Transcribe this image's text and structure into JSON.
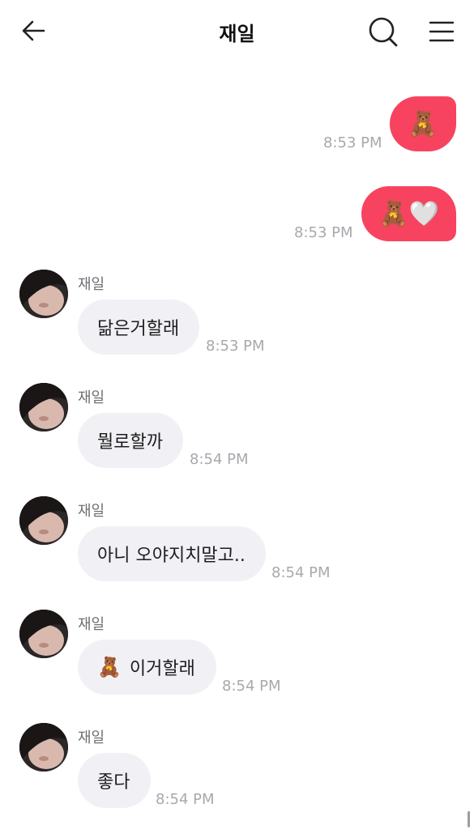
{
  "header": {
    "title": "재일"
  },
  "messages": [
    {
      "type": "outgoing",
      "emoji": "🧸",
      "time": "8:53 PM"
    },
    {
      "type": "outgoing",
      "emoji": "🧸🤍",
      "time": "8:53 PM"
    },
    {
      "type": "incoming",
      "sender": "재일",
      "text": "닮은거할래",
      "time": "8:53 PM"
    },
    {
      "type": "incoming",
      "sender": "재일",
      "text": "뭘로할까",
      "time": "8:54 PM"
    },
    {
      "type": "incoming",
      "sender": "재일",
      "text": "아니 오야지치말고..",
      "time": "8:54 PM"
    },
    {
      "type": "incoming",
      "sender": "재일",
      "emoji": "🧸",
      "text": "이거할래",
      "time": "8:54 PM"
    },
    {
      "type": "incoming",
      "sender": "재일",
      "text": "좋다",
      "time": "8:54 PM"
    }
  ],
  "colors": {
    "outgoing_bubble": "#f7435f",
    "incoming_bubble": "#f1f1f5",
    "timestamp": "#a8a8ae"
  },
  "icons": [
    "back-arrow-icon",
    "search-icon",
    "menu-icon",
    "teddy-bear-emoji",
    "white-heart-emoji"
  ]
}
